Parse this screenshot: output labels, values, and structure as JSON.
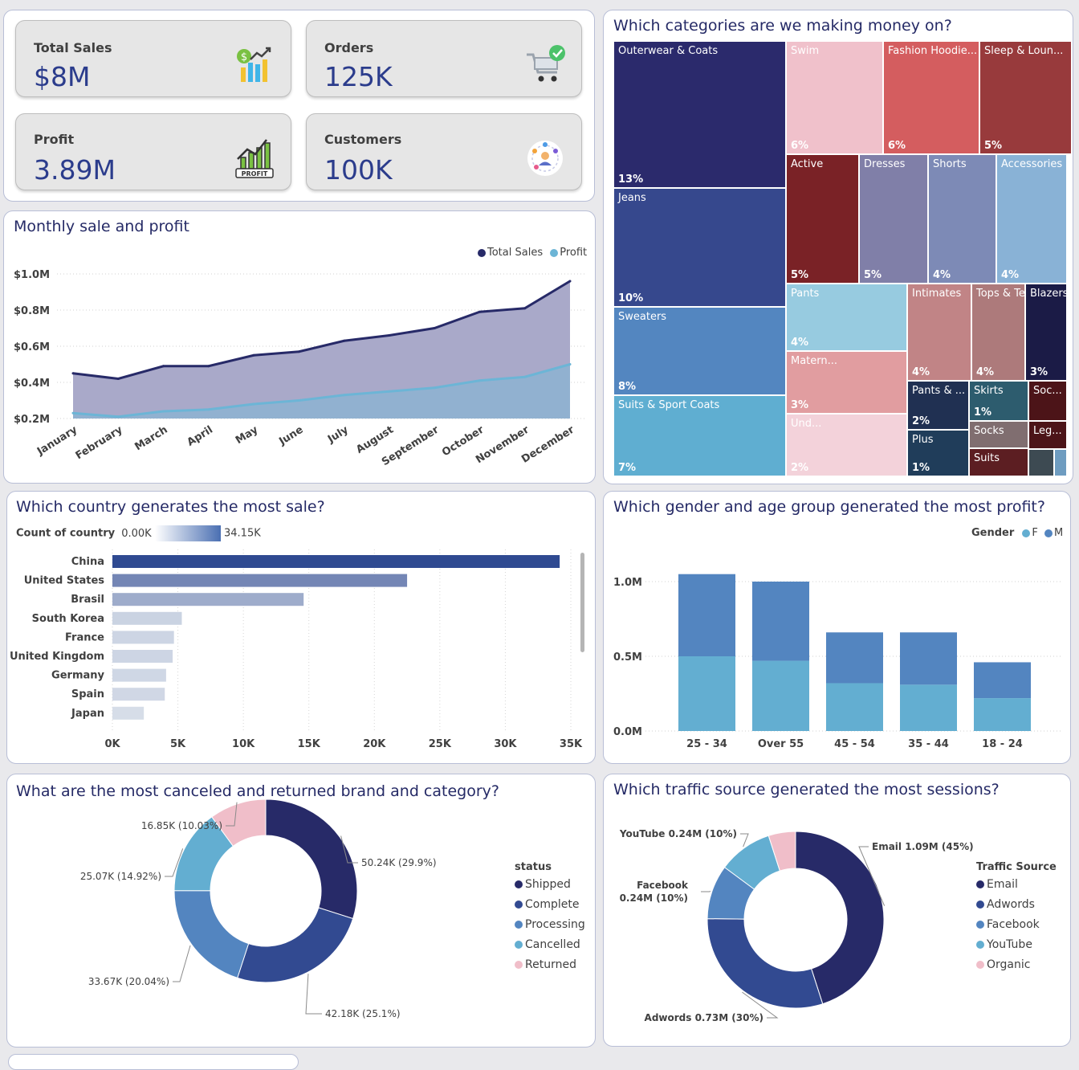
{
  "kpis": {
    "total_sales": {
      "label": "Total Sales",
      "value": "$8M"
    },
    "orders": {
      "label": "Orders",
      "value": "125K"
    },
    "profit": {
      "label": "Profit",
      "value": "3.89M"
    },
    "customers": {
      "label": "Customers",
      "value": "100K"
    }
  },
  "icons": {
    "total_sales": "money-growth-chart-icon",
    "orders": "shopping-cart-check-icon",
    "profit": "profit-growth-icon",
    "customers": "customer-network-icon"
  },
  "monthly": {
    "title": "Monthly sale and profit",
    "legend": [
      "Total Sales",
      "Profit"
    ],
    "colors": {
      "sales": "#272a68",
      "sales_fill": "#a9a9c9",
      "profit": "#6cb5d6",
      "profit_fill": "#8eb1d0"
    },
    "yticks": [
      "$1.0M",
      "$0.8M",
      "$0.6M",
      "$0.4M",
      "$0.2M"
    ]
  },
  "treemap": {
    "title": "Which categories are we making money on?",
    "items": [
      {
        "name": "Outerwear & Coats",
        "pct": "13%"
      },
      {
        "name": "Jeans",
        "pct": "10%"
      },
      {
        "name": "Sweaters",
        "pct": "8%"
      },
      {
        "name": "Suits & Sport Coats",
        "pct": "7%"
      },
      {
        "name": "Swim",
        "pct": "6%"
      },
      {
        "name": "Fashion Hoodie...",
        "pct": "6%"
      },
      {
        "name": "Sleep & Loun...",
        "pct": "5%"
      },
      {
        "name": "Active",
        "pct": "5%"
      },
      {
        "name": "Dresses",
        "pct": "5%"
      },
      {
        "name": "Shorts",
        "pct": "4%"
      },
      {
        "name": "Accessories",
        "pct": "4%"
      },
      {
        "name": "Pants",
        "pct": "4%"
      },
      {
        "name": "Intimates",
        "pct": "4%"
      },
      {
        "name": "Tops & Tees",
        "pct": "4%"
      },
      {
        "name": "Blazers &...",
        "pct": "3%"
      },
      {
        "name": "Matern...",
        "pct": "3%"
      },
      {
        "name": "Und...",
        "pct": "2%"
      },
      {
        "name": "Pants & ...",
        "pct": "2%"
      },
      {
        "name": "Plus",
        "pct": "1%"
      },
      {
        "name": "Skirts",
        "pct": "1%"
      },
      {
        "name": "Soc...",
        "pct": ""
      },
      {
        "name": "Socks",
        "pct": ""
      },
      {
        "name": "Leg...",
        "pct": ""
      },
      {
        "name": "Suits",
        "pct": ""
      }
    ]
  },
  "country": {
    "title": "Which country generates the most sale?",
    "legend_label": "Count of country",
    "legend_min": "0.00K",
    "legend_max": "34.15K"
  },
  "gender": {
    "title": "Which gender and age group generated the most profit?",
    "legend_label": "Gender",
    "legend": [
      "F",
      "M"
    ]
  },
  "returns": {
    "title": "What are the most canceled and returned brand and category?",
    "legend_title": "status",
    "labels": [
      "50.24K (29.9%)",
      "42.18K (25.1%)",
      "33.67K (20.04%)",
      "25.07K (14.92%)",
      "16.85K (10.03%)"
    ]
  },
  "traffic": {
    "title": "Which traffic source generated the most sessions?",
    "legend_title": "Traffic Source",
    "labels": {
      "email": "Email 1.09M (45%)",
      "adwords": "Adwords 0.73M (30%)",
      "facebook_1": "Facebook",
      "facebook_2": "0.24M (10%)",
      "youtube": "YouTube 0.24M (10%)"
    }
  },
  "chart_data": [
    {
      "type": "area",
      "title": "Monthly sale and profit",
      "x": [
        "January",
        "February",
        "March",
        "April",
        "May",
        "June",
        "July",
        "August",
        "September",
        "October",
        "November",
        "December"
      ],
      "series": [
        {
          "name": "Total Sales",
          "values": [
            0.45,
            0.42,
            0.49,
            0.49,
            0.55,
            0.57,
            0.63,
            0.66,
            0.7,
            0.79,
            0.81,
            0.96
          ]
        },
        {
          "name": "Profit",
          "values": [
            0.23,
            0.21,
            0.24,
            0.25,
            0.28,
            0.3,
            0.33,
            0.35,
            0.37,
            0.41,
            0.43,
            0.5
          ]
        }
      ],
      "ylabel": "",
      "yticks": [
        "$1.0M",
        "$0.8M",
        "$0.6M",
        "$0.4M",
        "$0.2M"
      ],
      "ylim": [
        0.2,
        1.0
      ],
      "grid": true,
      "legend_position": "top-right"
    },
    {
      "type": "bar",
      "title": "Which country generates the most sale?",
      "orientation": "horizontal",
      "categories": [
        "China",
        "United States",
        "Brasil",
        "South Korea",
        "France",
        "United Kingdom",
        "Germany",
        "Spain",
        "Japan"
      ],
      "values": [
        34150,
        22500,
        14600,
        5300,
        4700,
        4600,
        4100,
        4000,
        2400
      ],
      "xticks": [
        "0K",
        "5K",
        "10K",
        "15K",
        "20K",
        "25K",
        "30K",
        "35K"
      ],
      "xlim": [
        0,
        35000
      ],
      "color_scale": [
        "#dde3ec",
        "#2f4a91"
      ]
    },
    {
      "type": "bar",
      "stacked": true,
      "title": "Which gender and age group generated the most profit?",
      "categories": [
        "25 - 34",
        "Over 55",
        "45 - 54",
        "35 - 44",
        "18 - 24"
      ],
      "series": [
        {
          "name": "F",
          "values": [
            0.5,
            0.47,
            0.32,
            0.31,
            0.22
          ],
          "color": "#63aed1"
        },
        {
          "name": "M",
          "values": [
            0.55,
            0.53,
            0.34,
            0.35,
            0.24
          ],
          "color": "#5385c0"
        }
      ],
      "yticks": [
        "1.0M",
        "0.5M",
        "0.0M"
      ],
      "ylim": [
        0,
        1.1
      ],
      "legend_position": "top-right"
    },
    {
      "type": "pie",
      "donut": true,
      "title": "What are the most canceled and returned brand and category?",
      "labels": [
        "Shipped",
        "Complete",
        "Processing",
        "Cancelled",
        "Returned"
      ],
      "values": [
        50.24,
        42.18,
        33.67,
        25.07,
        16.85
      ],
      "percent": [
        29.9,
        25.1,
        20.04,
        14.92,
        10.03
      ],
      "colors": [
        "#272a68",
        "#324a91",
        "#5385c0",
        "#63aed1",
        "#f0bec9"
      ],
      "legend_position": "right"
    },
    {
      "type": "pie",
      "donut": true,
      "title": "Which traffic source generated the most sessions?",
      "labels": [
        "Email",
        "Adwords",
        "Facebook",
        "YouTube",
        "Organic"
      ],
      "values": [
        1.09,
        0.73,
        0.24,
        0.24,
        0.12
      ],
      "percent": [
        45,
        30,
        10,
        10,
        5
      ],
      "colors": [
        "#272a68",
        "#324a91",
        "#5385c0",
        "#63aed1",
        "#f0bec9"
      ],
      "legend_position": "right"
    }
  ]
}
